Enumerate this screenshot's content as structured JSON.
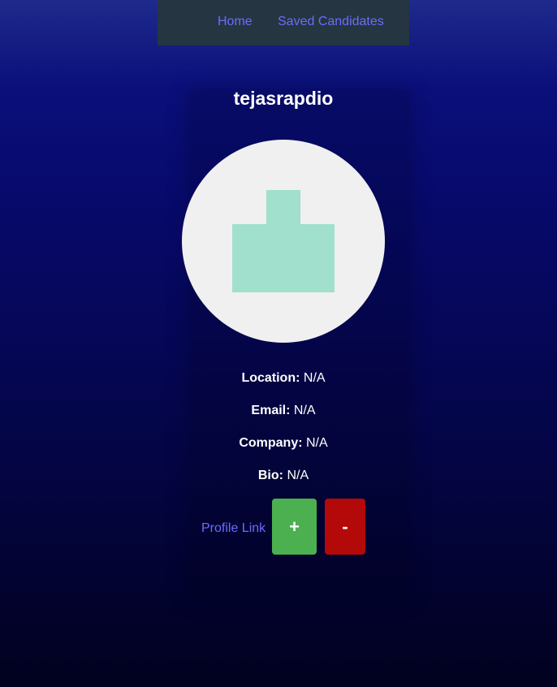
{
  "nav": {
    "home_label": "Home",
    "saved_label": "Saved Candidates"
  },
  "candidate": {
    "username": "tejasrapdio",
    "avatar_icon": "default-avatar-icon",
    "location_label": "Location:",
    "location_value": "N/A",
    "email_label": "Email:",
    "email_value": "N/A",
    "company_label": "Company:",
    "company_value": "N/A",
    "bio_label": "Bio:",
    "bio_value": "N/A",
    "profile_link_label": "Profile Link"
  },
  "actions": {
    "add_label": "+",
    "remove_label": "-"
  },
  "colors": {
    "nav_bg": "#253541",
    "link": "#6b6cff",
    "add_button": "#4caf50",
    "remove_button": "#b30909",
    "avatar_bg": "#f0f0f0",
    "avatar_shape": "#a0e0cd"
  }
}
